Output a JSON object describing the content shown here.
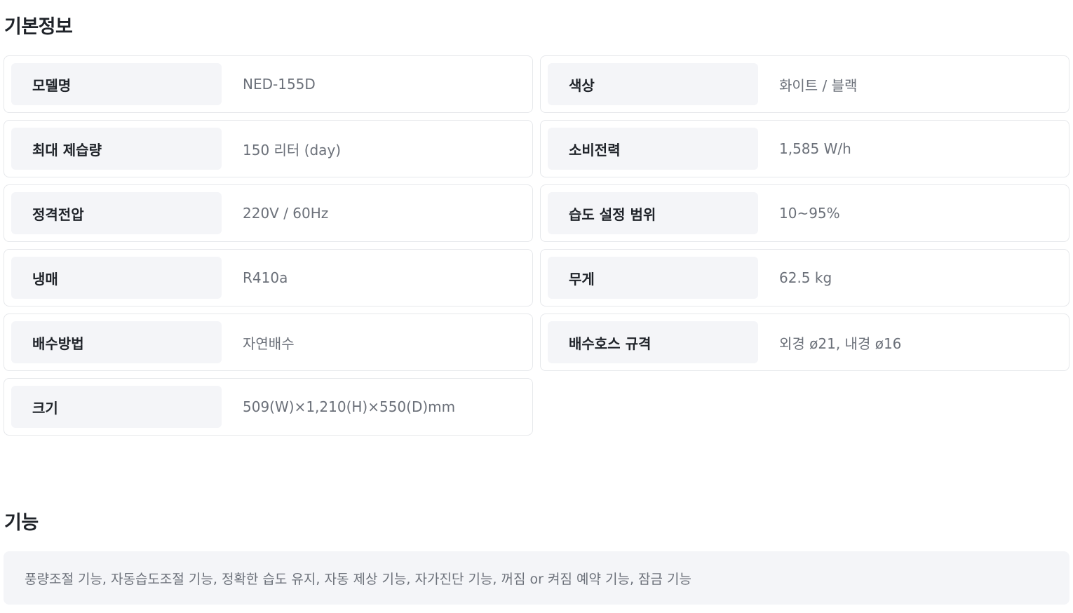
{
  "basic_info": {
    "title": "기본정보",
    "specs": [
      {
        "label": "모델명",
        "value": "NED-155D"
      },
      {
        "label": "색상",
        "value": "화이트 / 블랙"
      },
      {
        "label": "최대 제습량",
        "value": "150 리터 (day)"
      },
      {
        "label": "소비전력",
        "value": "1,585 W/h"
      },
      {
        "label": "정격전압",
        "value": "220V / 60Hz"
      },
      {
        "label": "습도 설정 범위",
        "value": "10~95%"
      },
      {
        "label": "냉매",
        "value": "R410a"
      },
      {
        "label": "무게",
        "value": "62.5 kg"
      },
      {
        "label": "배수방법",
        "value": "자연배수"
      },
      {
        "label": "배수호스 규격",
        "value": "외경 ø21, 내경 ø16"
      },
      {
        "label": "크기",
        "value": "509(W)×1,210(H)×550(D)mm"
      }
    ]
  },
  "features": {
    "title": "기능",
    "text": "풍량조절 기능, 자동습도조절 기능, 정확한 습도 유지, 자동 제상 기능, 자가진단 기능, 꺼짐 or 켜짐 예약 기능, 잠금 기능"
  }
}
